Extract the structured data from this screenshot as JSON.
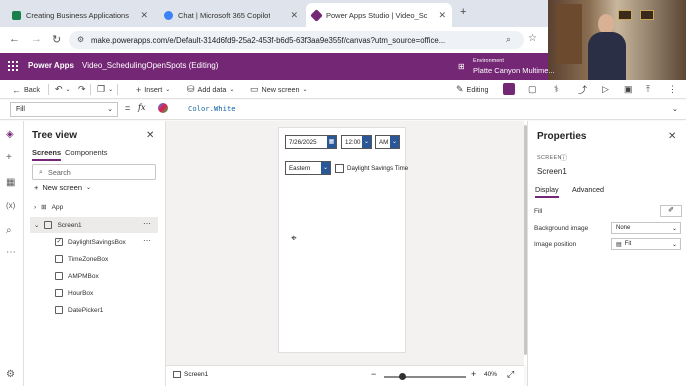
{
  "browser": {
    "tabs": [
      {
        "label": "Creating Business Applications",
        "favicon_color": "#1a7f4b"
      },
      {
        "label": "Chat | Microsoft 365 Copilot",
        "favicon_color": "#3b82f6"
      },
      {
        "label": "Power Apps Studio | Video_Sc",
        "favicon_color": "#742774"
      }
    ],
    "new_tab": "+",
    "url": "make.powerapps.com/e/Default-314d6fd9-25a2-453f-b6d5-63f3aa9e355f/canvas?utm_source=office..."
  },
  "header": {
    "app_name": "Power Apps",
    "file_title": "Video_SchedulingOpenSpots (Editing)",
    "environment_label": "Environment",
    "environment_name": "Platte Canyon Multime..."
  },
  "commands": {
    "back": "Back",
    "insert": "Insert",
    "add_data": "Add data",
    "new_screen": "New screen",
    "editing": "Editing"
  },
  "formula_bar": {
    "property": "Fill",
    "fx": "fx",
    "formula_object": "Color",
    "formula_value": ".White"
  },
  "tree": {
    "title": "Tree view",
    "tabs": [
      "Screens",
      "Components"
    ],
    "search_placeholder": "Search",
    "new_screen": "New screen",
    "nodes": [
      "App",
      "Screen1",
      "DaylightSavingsBox",
      "TimeZoneBox",
      "AMPMBox",
      "HourBox",
      "DatePicker1"
    ]
  },
  "canvas": {
    "date_value": "7/26/2025",
    "hour_value": "12:00",
    "ampm_value": "AM",
    "timezone_value": "Eastern",
    "dst_label": "Daylight Savings Time"
  },
  "status": {
    "screen_name": "Screen1",
    "zoom": "40%",
    "zoom_fraction": 0.18
  },
  "properties": {
    "title": "Properties",
    "type_label": "SCREEN",
    "screen_name": "Screen1",
    "tabs": [
      "Display",
      "Advanced"
    ],
    "rows": [
      {
        "label": "Fill",
        "value": ""
      },
      {
        "label": "Background image",
        "value": "None"
      },
      {
        "label": "Image position",
        "value": "Fit"
      }
    ]
  }
}
